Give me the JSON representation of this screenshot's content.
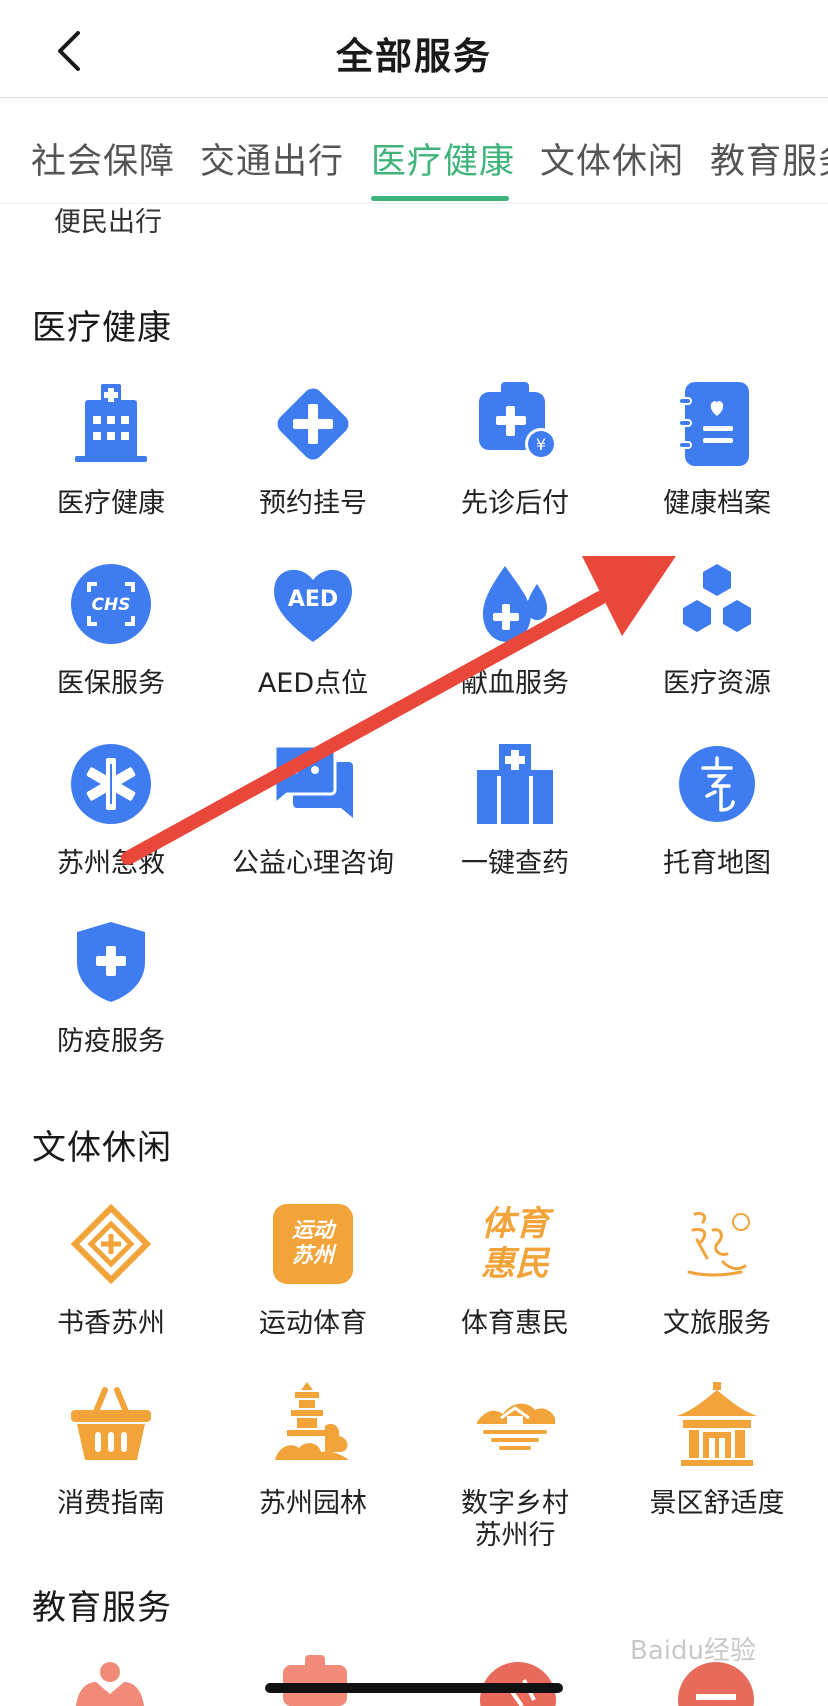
{
  "header": {
    "title": "全部服务"
  },
  "tabs": [
    {
      "label": "社会保障"
    },
    {
      "label": "交通出行"
    },
    {
      "label": "医疗健康",
      "active": true
    },
    {
      "label": "文体休闲"
    },
    {
      "label": "教育服务"
    }
  ],
  "prev_section_item": "便民出行",
  "medical": {
    "title": "医疗健康",
    "items": [
      {
        "label": "医疗健康",
        "icon": "hospital-building-icon"
      },
      {
        "label": "预约挂号",
        "icon": "diamond-plus-icon"
      },
      {
        "label": "先诊后付",
        "icon": "medkit-yen-icon"
      },
      {
        "label": "健康档案",
        "icon": "health-record-book-icon"
      },
      {
        "label": "医保服务",
        "icon": "chs-scan-icon"
      },
      {
        "label": "AED点位",
        "icon": "aed-heart-icon"
      },
      {
        "label": "献血服务",
        "icon": "blood-drop-icon"
      },
      {
        "label": "医疗资源",
        "icon": "hexagon-cubes-icon"
      },
      {
        "label": "苏州急救",
        "icon": "star-of-life-icon"
      },
      {
        "label": "公益心理咨询",
        "icon": "chat-bubbles-icon"
      },
      {
        "label": "一键查药",
        "icon": "pharmacy-building-icon"
      },
      {
        "label": "托育地图",
        "icon": "childcare-logo-icon"
      },
      {
        "label": "防疫服务",
        "icon": "shield-plus-icon"
      }
    ]
  },
  "culture": {
    "title": "文体休闲",
    "items": [
      {
        "label": "书香苏州",
        "icon": "book-fragrance-logo-icon"
      },
      {
        "label": "运动体育",
        "icon": "sport-suzhou-logo-icon",
        "logo_text": "运动苏州"
      },
      {
        "label": "体育惠民",
        "icon": "sports-benefit-logo-icon",
        "logo_text": "体育惠民"
      },
      {
        "label": "文旅服务",
        "icon": "culture-tourism-logo-icon"
      },
      {
        "label": "消费指南",
        "icon": "shopping-basket-icon"
      },
      {
        "label": "苏州园林",
        "icon": "pagoda-garden-icon"
      },
      {
        "label": "数字乡村\n苏州行",
        "icon": "village-landscape-icon"
      },
      {
        "label": "景区舒适度",
        "icon": "pavilion-icon"
      }
    ]
  },
  "education": {
    "title": "教育服务"
  },
  "watermark": "Baidu经验",
  "colors": {
    "accent_green": "#3fb47a",
    "medical_blue": "#3e7cf0",
    "culture_orange": "#f2a33a",
    "annotation_red": "#e8473a"
  }
}
